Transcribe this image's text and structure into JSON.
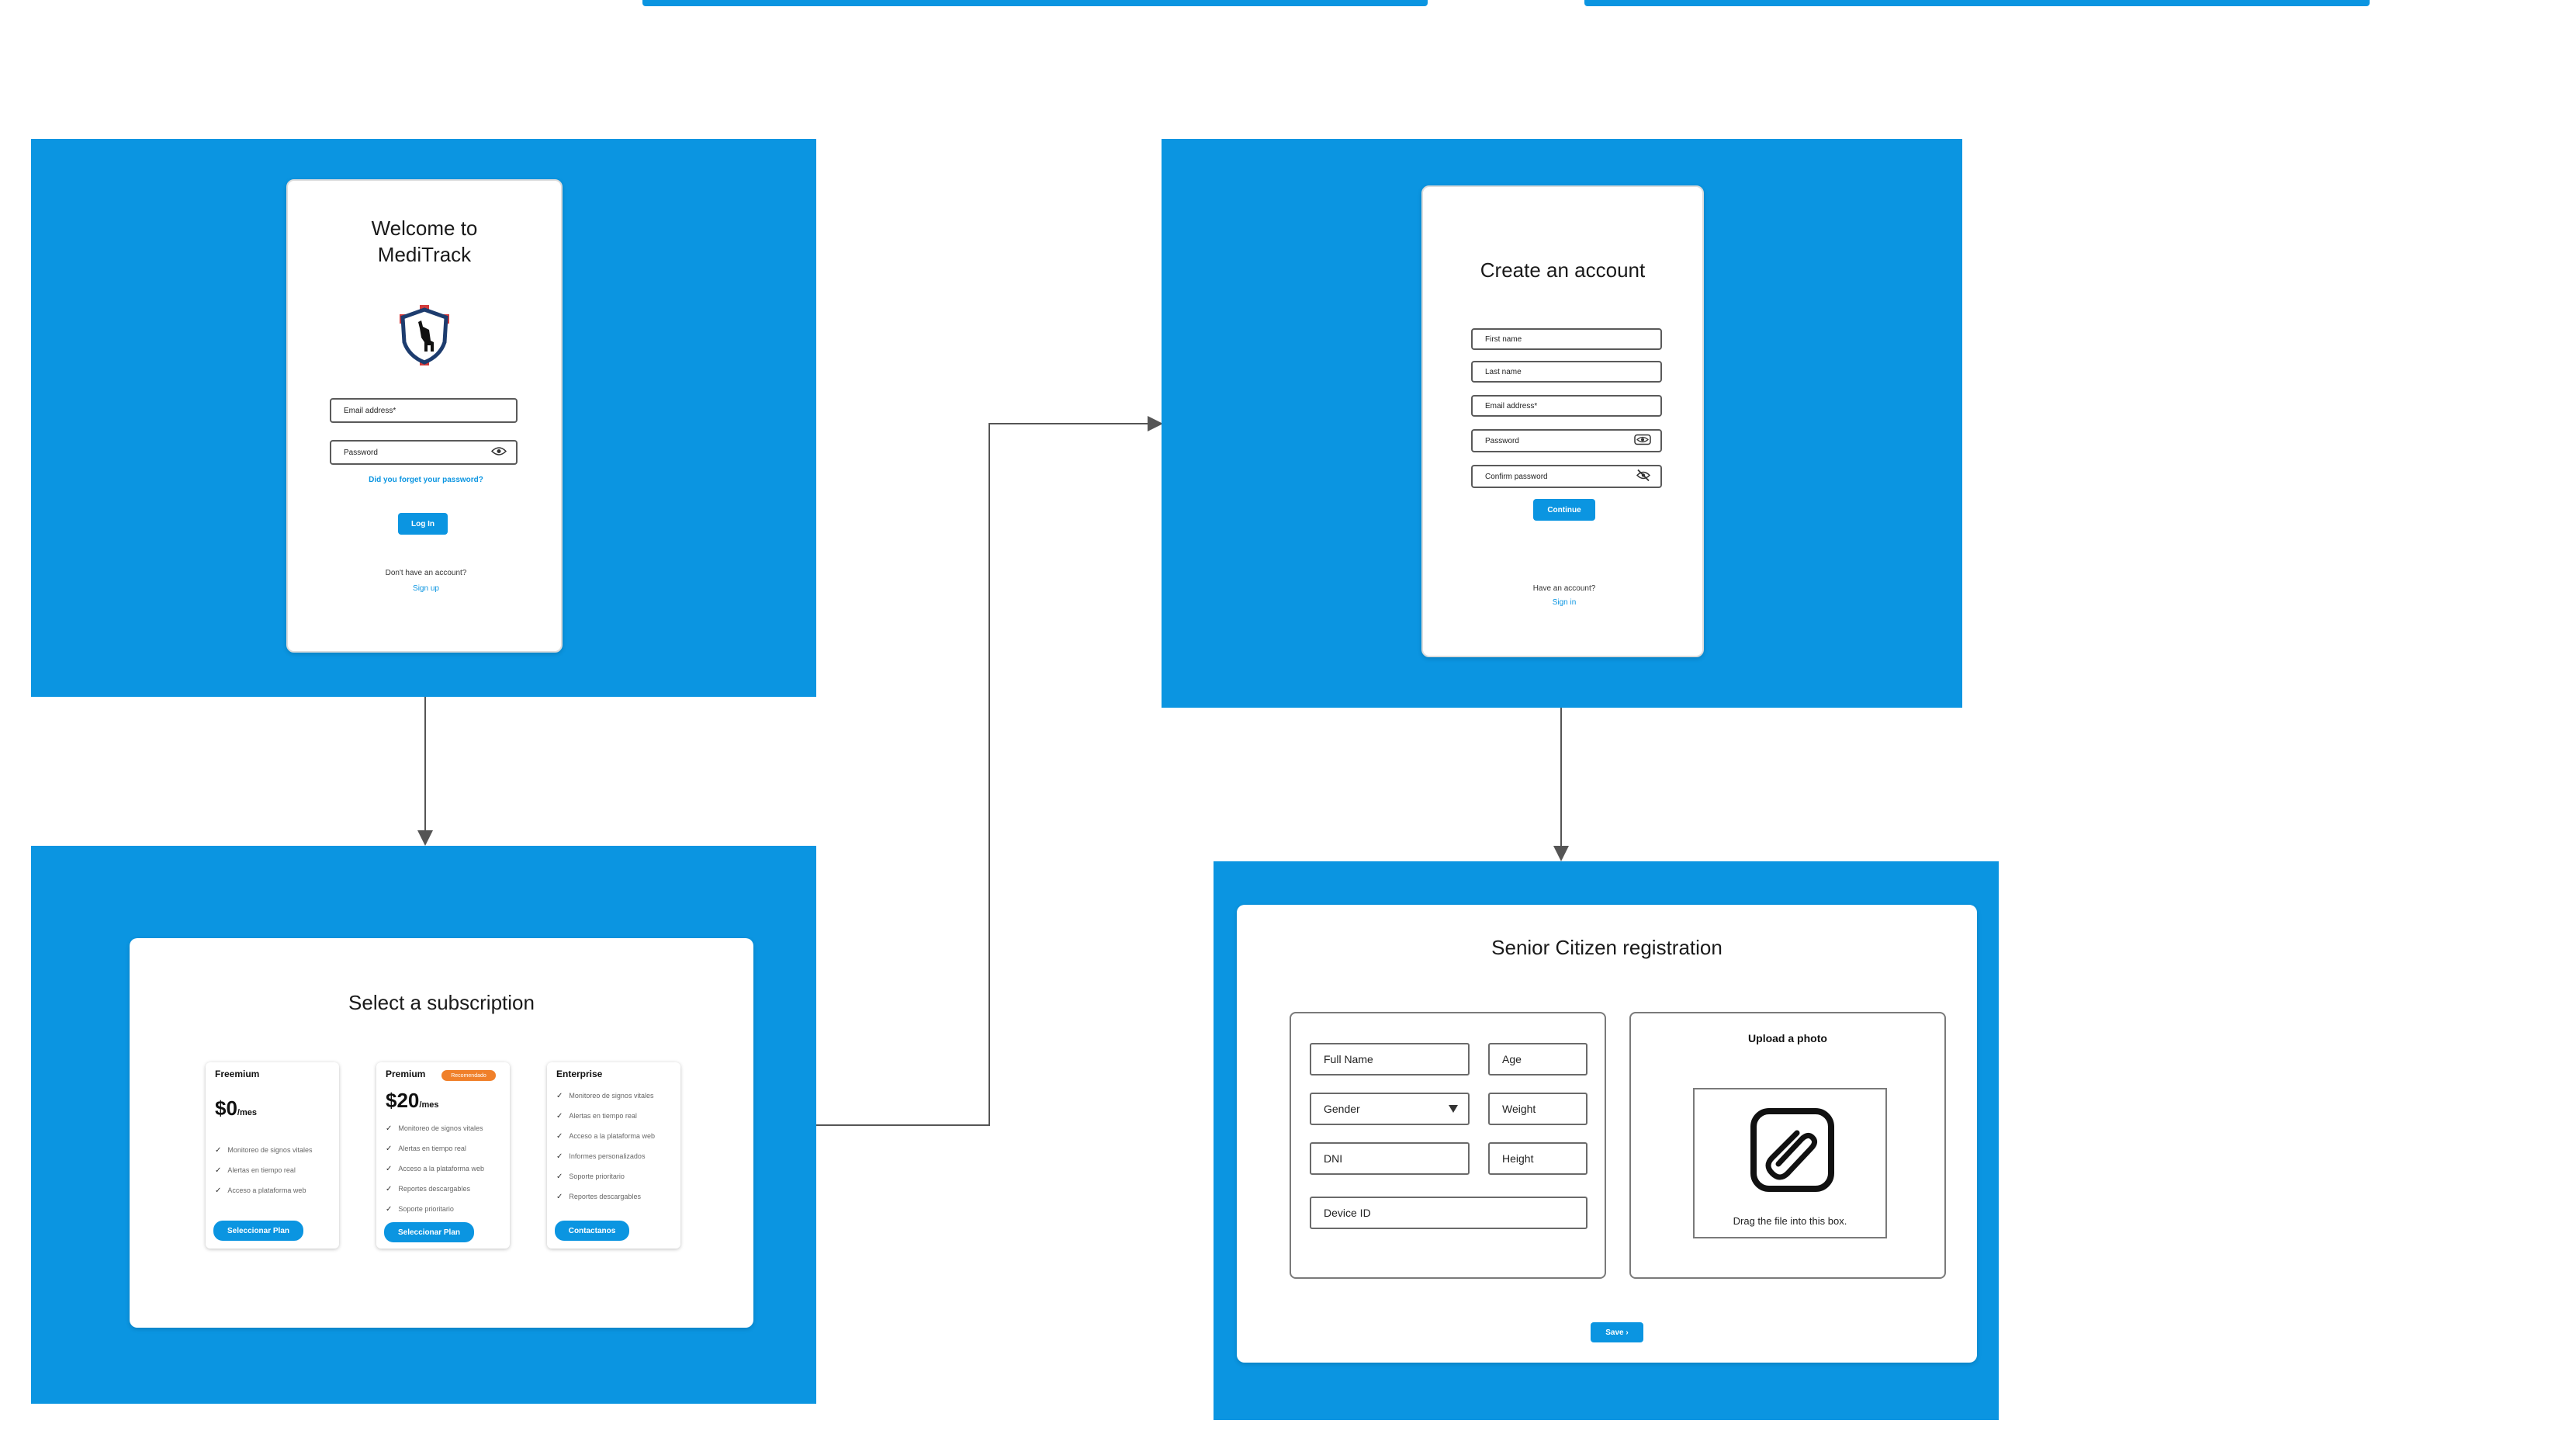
{
  "colors": {
    "frame": "#0b95e1",
    "accent": "#0b95e1",
    "badge": "#f0802a",
    "connector": "#555555"
  },
  "login": {
    "title_line1": "Welcome to",
    "title_line2": "MediTrack",
    "logo_icon": "shield-llama-logo",
    "email_placeholder": "Email address*",
    "password_placeholder": "Password",
    "forgot_link": "Did you forget your password?",
    "login_button": "Log In",
    "no_account_text": "Don't have an account?",
    "signup_link": "Sign up"
  },
  "create_account": {
    "title": "Create an account",
    "first_name": "First name",
    "last_name": "Last name",
    "email": "Email address*",
    "password": "Password",
    "confirm_password": "Confirm password",
    "continue_button": "Continue",
    "have_account_text": "Have an account?",
    "signin_link": "Sign in"
  },
  "subscription": {
    "title": "Select a subscription",
    "plans": [
      {
        "name": "Freemium",
        "price": "$0",
        "per": "/mes",
        "badge": "",
        "features": [
          "Monitoreo de signos vitales",
          "Alertas en tiempo real",
          "Acceso a plataforma web"
        ],
        "button": "Seleccionar Plan"
      },
      {
        "name": "Premium",
        "price": "$20",
        "per": "/mes",
        "badge": "Recomendado",
        "features": [
          "Monitoreo de signos vitales",
          "Alertas en tiempo real",
          "Acceso a la plataforma web",
          "Reportes descargables",
          "Soporte prioritario"
        ],
        "button": "Seleccionar Plan"
      },
      {
        "name": "Enterprise",
        "price": "",
        "per": "",
        "badge": "",
        "features": [
          "Monitoreo de signos vitales",
          "Alertas en tiempo real",
          "Acceso a la plataforma web",
          "Informes personalizados",
          "Soporte prioritario",
          "Reportes descargables"
        ],
        "button": "Contactanos"
      }
    ]
  },
  "registration": {
    "title": "Senior Citizen registration",
    "full_name": "Full Name",
    "age": "Age",
    "gender": "Gender",
    "weight": "Weight",
    "dni": "DNI",
    "height": "Height",
    "device_id": "Device ID",
    "upload_title": "Upload a photo",
    "upload_icon": "paperclip-icon",
    "drag_text": "Drag the file into this box.",
    "save_button": "Save",
    "save_arrow": "›"
  }
}
